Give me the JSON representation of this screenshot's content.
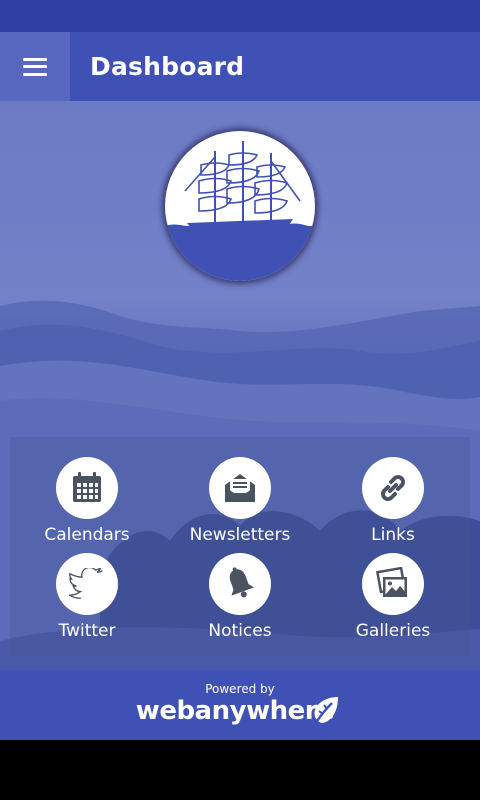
{
  "header": {
    "menu_icon": "hamburger-menu-icon",
    "title": "Dashboard"
  },
  "logo": {
    "icon": "sailing-ship-logo"
  },
  "tiles": [
    {
      "label": "Calendars",
      "icon": "calendar-icon"
    },
    {
      "label": "Newsletters",
      "icon": "envelope-icon"
    },
    {
      "label": "Links",
      "icon": "link-icon"
    },
    {
      "label": "Twitter",
      "icon": "twitter-bird-icon"
    },
    {
      "label": "Notices",
      "icon": "bell-icon"
    },
    {
      "label": "Galleries",
      "icon": "gallery-icon"
    }
  ],
  "footer": {
    "powered_by": "Powered by",
    "brand": "webanywhere",
    "brand_icon": "leaf-icon"
  },
  "colors": {
    "primary": "#3f51b5",
    "status_bar": "#2f3fa3",
    "menu_button": "#5868c0",
    "icon": "#4a5361"
  }
}
